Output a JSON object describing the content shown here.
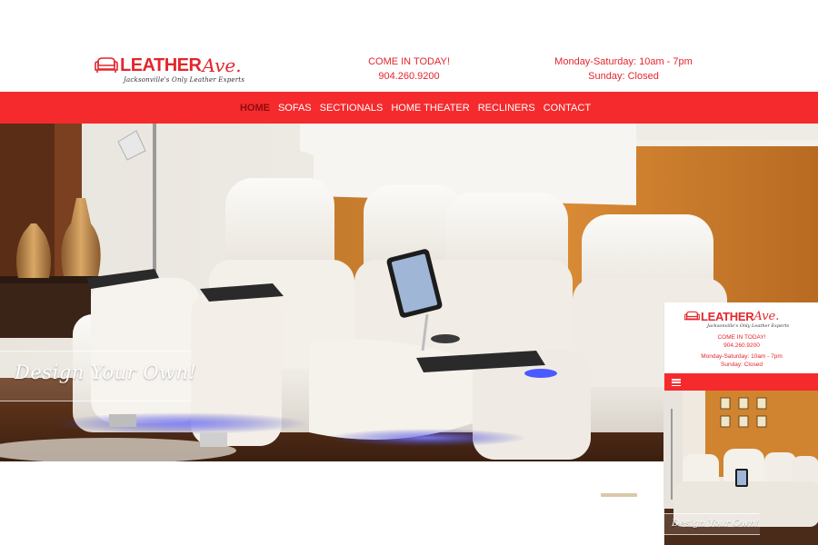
{
  "brand": {
    "name": "LEATHER",
    "name_script": "Ave.",
    "tagline": "Jacksonville's Only Leather Experts",
    "accent": "#f52a2c",
    "text_red": "#e3262d"
  },
  "contact": {
    "cta": "COME IN TODAY!",
    "phone": "904.260.9200"
  },
  "hours": {
    "weekdays": "Monday-Saturday: 10am - 7pm",
    "sunday": "Sunday: Closed"
  },
  "nav": {
    "items": [
      "HOME",
      "SOFAS",
      "SECTIONALS",
      "HOME THEATER",
      "RECLINERS",
      "CONTACT"
    ],
    "active": "HOME"
  },
  "hero": {
    "caption": "Design Your Own!"
  },
  "mobile": {
    "brand_name": "LEATHER",
    "brand_script": "Ave.",
    "tagline": "Jacksonville's Only Leather Experts",
    "cta": "COME IN TODAY!",
    "phone": "904.260.9200",
    "hours_weekdays": "Monday-Saturday: 10am - 7pm",
    "hours_sunday": "Sunday: Closed",
    "caption": "Design Your Own!"
  }
}
